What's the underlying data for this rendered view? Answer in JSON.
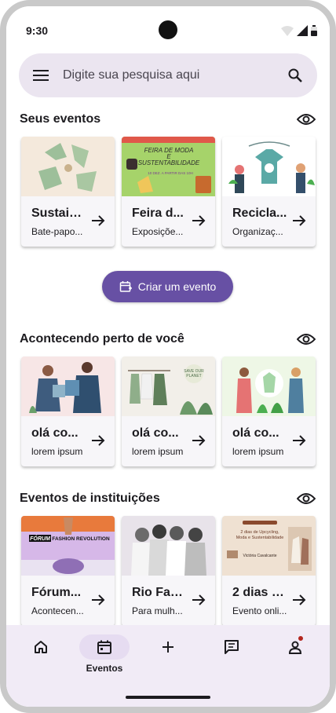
{
  "status_bar": {
    "time": "9:30"
  },
  "search": {
    "placeholder": "Digite sua pesquisa aqui"
  },
  "sections": [
    {
      "title": "Seus eventos",
      "cards": [
        {
          "title": "Sustain...",
          "subtitle": "Bate-papo...",
          "image": "recycle-illustration"
        },
        {
          "title": "Feira d...",
          "subtitle": "Exposiçõe...",
          "image": "fair-poster",
          "poster_lines": [
            "FEIRA DE MODA",
            "E",
            "SUSTENTABILIDADE"
          ],
          "poster_small": "10 DEZ. A PARTIR DAS 10H"
        },
        {
          "title": "Recicla...",
          "subtitle": "Organizaç...",
          "image": "recycling-people"
        }
      ]
    },
    {
      "title": "Acontecendo perto de você",
      "cards": [
        {
          "title": "olá co...",
          "subtitle": "lorem ipsum",
          "image": "people-clothes"
        },
        {
          "title": "olá co...",
          "subtitle": "lorem ipsum",
          "image": "clothes-rack",
          "poster_lines": [
            "SAVE OUR",
            "PLANET"
          ]
        },
        {
          "title": "olá co...",
          "subtitle": "lorem ipsum",
          "image": "people-plants"
        }
      ]
    },
    {
      "title": "Eventos de instituições",
      "cards": [
        {
          "title": "Fórum...",
          "subtitle": "Acontecen...",
          "image": "forum-fashion",
          "poster_lines": [
            "FÓRUM",
            "FASHION REVOLUTION"
          ]
        },
        {
          "title": "Rio Fas...",
          "subtitle": "Para mulh...",
          "image": "women-photo"
        },
        {
          "title": "2 dias d...",
          "subtitle": "Evento onli...",
          "image": "upcycling-poster",
          "poster_lines": [
            "2 dias de Upcycling,",
            "Moda e Sustentabilidade"
          ],
          "poster_small": "Victória Cavalcante"
        }
      ]
    }
  ],
  "create_event": {
    "label": "Criar um evento"
  },
  "bottom_nav": {
    "items": [
      {
        "id": "home",
        "label": ""
      },
      {
        "id": "eventos",
        "label": "Eventos",
        "active": true
      },
      {
        "id": "add",
        "label": ""
      },
      {
        "id": "messages",
        "label": ""
      },
      {
        "id": "profile",
        "label": "",
        "badge": true
      }
    ]
  },
  "colors": {
    "accent": "#6750a4",
    "search_bg": "#ebe5f0",
    "nav_bg": "#f1ebf6",
    "active_pill": "#e6dcf1",
    "badge": "#b3261e"
  }
}
